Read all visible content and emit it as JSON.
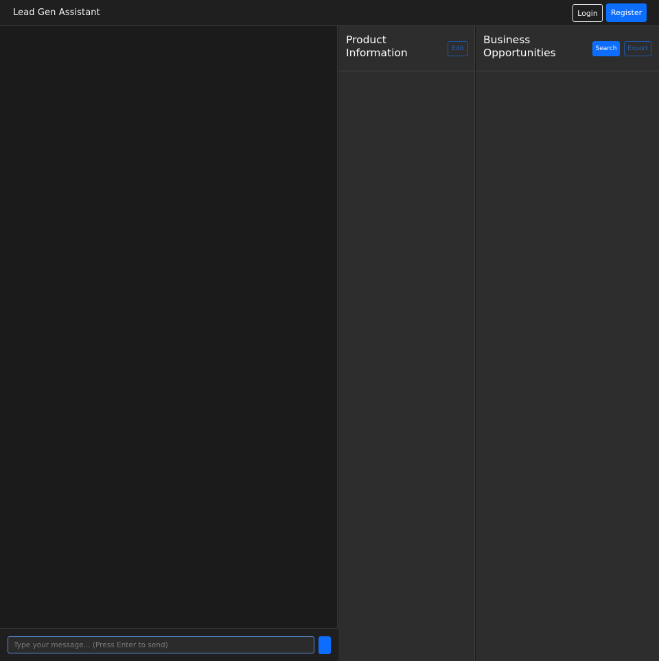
{
  "header": {
    "app_title": "Lead Gen Assistant",
    "login_label": "Login",
    "register_label": "Register"
  },
  "chat": {
    "input_placeholder": "Type your message... (Press Enter to send)",
    "input_value": ""
  },
  "product_panel": {
    "title": "Product\nInformation",
    "edit_label": "Edit"
  },
  "business_panel": {
    "title": "Business\nOpportunities",
    "search_label": "Search",
    "export_label": "Export"
  },
  "colors": {
    "accent": "#0d6efd",
    "background": "#1b1b1b",
    "panel_background": "#2d2d2d"
  }
}
